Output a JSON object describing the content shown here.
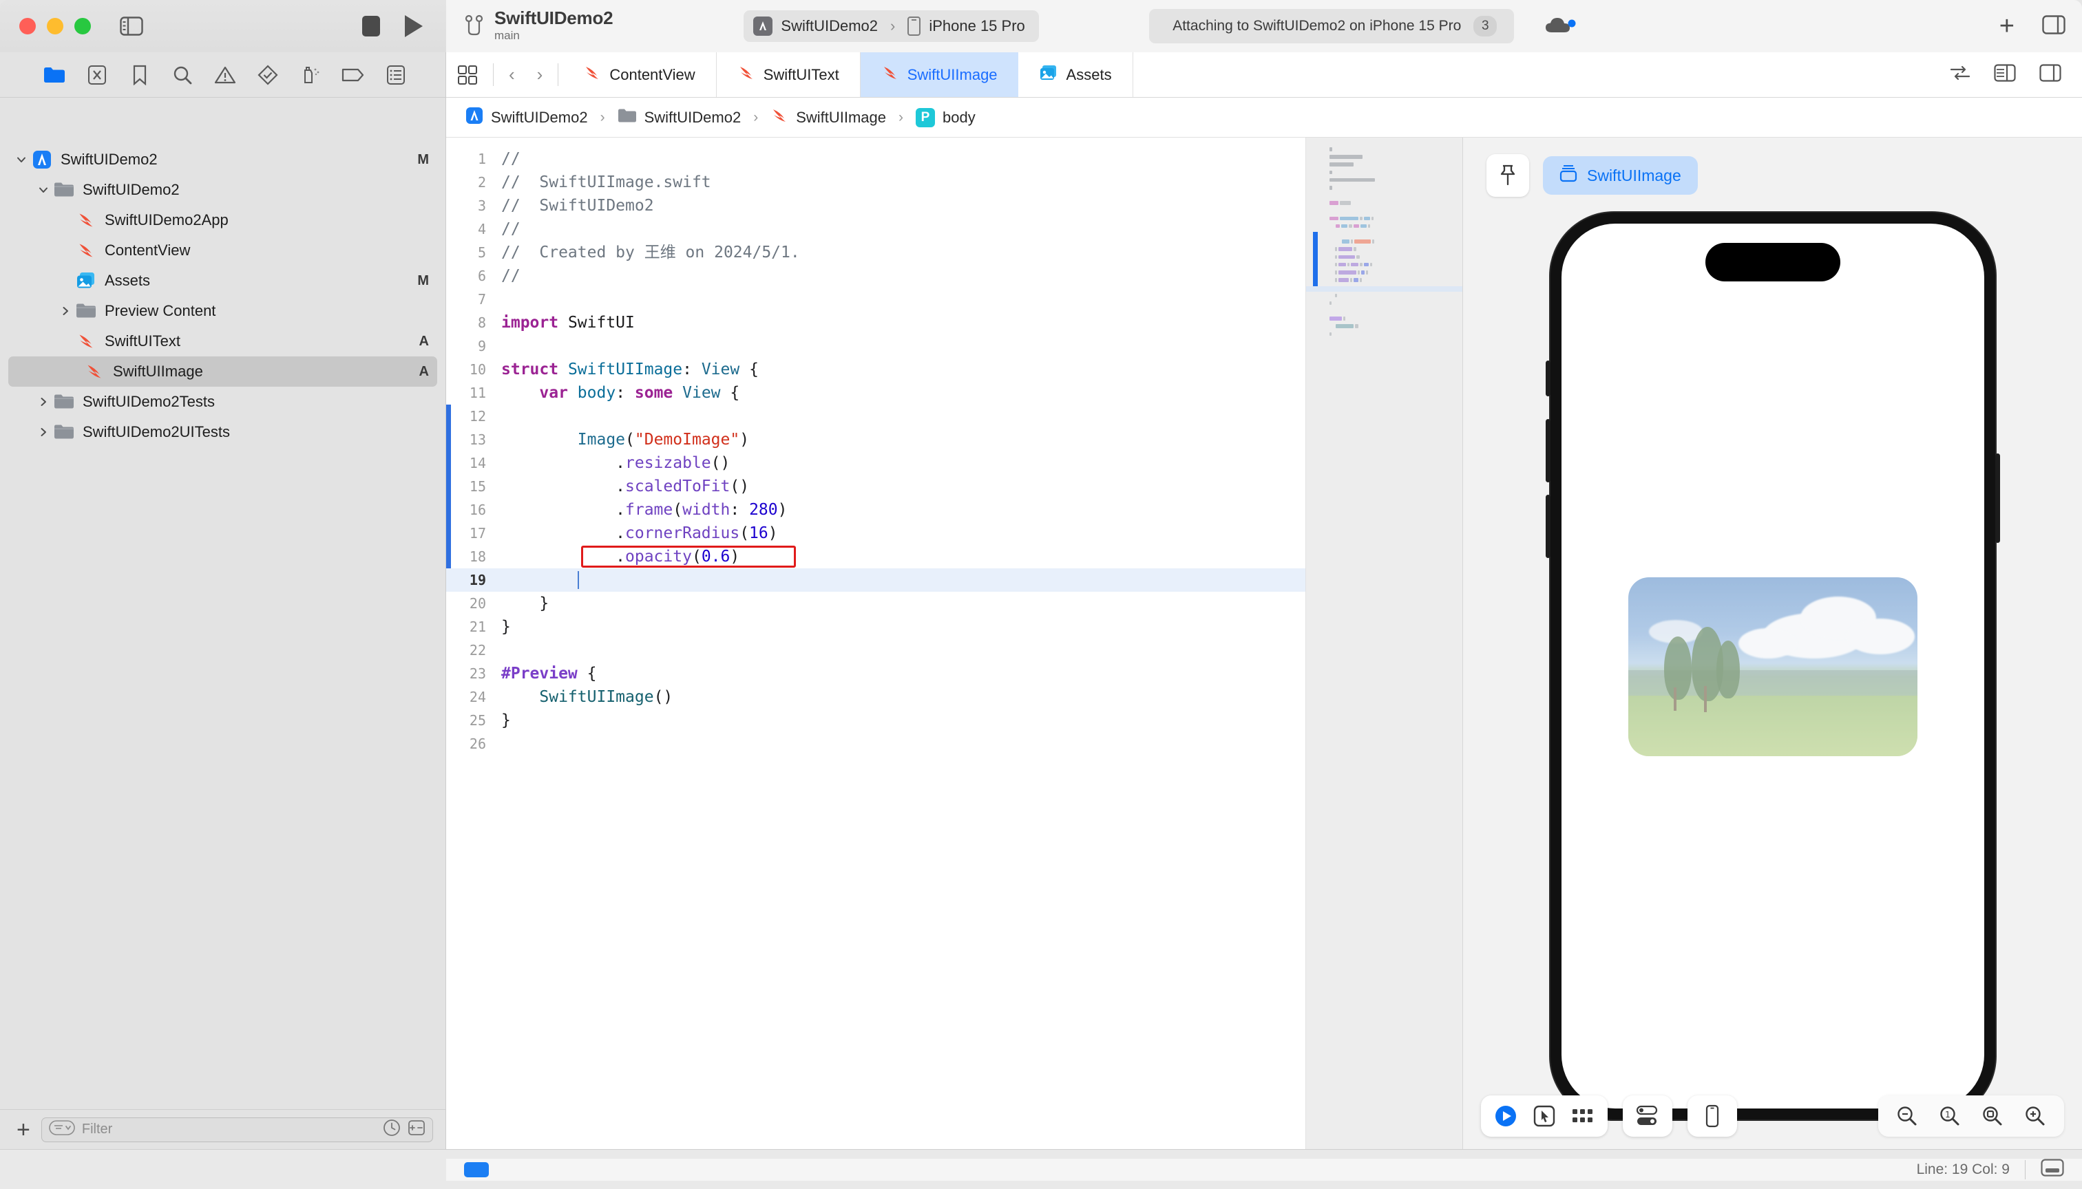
{
  "window": {
    "project_title": "SwiftUIDemo2",
    "branch": "main",
    "traffic_lights": [
      "close",
      "minimize",
      "zoom"
    ]
  },
  "toolbar": {
    "sidebar_toggle_icon": "sidebar-toggle-icon",
    "stop_icon": "stop-icon",
    "run_icon": "run-icon",
    "branch_icon": "source-control-branch-icon",
    "scheme": {
      "app_name": "SwiftUIDemo2",
      "separator": "›",
      "destination": "iPhone 15 Pro"
    },
    "status": {
      "message": "Attaching to SwiftUIDemo2 on iPhone 15 Pro",
      "count": "3"
    },
    "cloud_icon": "cloud-status-icon",
    "add_icon": "plus-icon",
    "inspector_toggle_icon": "inspector-toggle-icon"
  },
  "navigator_toolbar": {
    "icons": [
      "folder-project-navigator-icon",
      "source-control-navigator-icon",
      "bookmark-navigator-icon",
      "search-navigator-icon",
      "issue-navigator-icon",
      "test-navigator-icon",
      "debug-navigator-icon",
      "breakpoint-navigator-icon",
      "report-navigator-icon"
    ]
  },
  "navigator": {
    "tree": [
      {
        "label": "SwiftUIDemo2",
        "icon": "xcode-project-icon",
        "depth": 0,
        "disclosure": "open",
        "badge": "M",
        "selected": false
      },
      {
        "label": "SwiftUIDemo2",
        "icon": "folder-icon",
        "depth": 1,
        "disclosure": "open",
        "badge": "",
        "selected": false
      },
      {
        "label": "SwiftUIDemo2App",
        "icon": "swift-file-icon",
        "depth": 2,
        "disclosure": "none",
        "badge": "",
        "selected": false
      },
      {
        "label": "ContentView",
        "icon": "swift-file-icon",
        "depth": 2,
        "disclosure": "none",
        "badge": "",
        "selected": false
      },
      {
        "label": "Assets",
        "icon": "assets-catalog-icon",
        "depth": 2,
        "disclosure": "none",
        "badge": "M",
        "selected": false
      },
      {
        "label": "Preview Content",
        "icon": "folder-icon",
        "depth": 2,
        "disclosure": "closed",
        "badge": "",
        "selected": false
      },
      {
        "label": "SwiftUIText",
        "icon": "swift-file-icon",
        "depth": 2,
        "disclosure": "none",
        "badge": "A",
        "selected": false
      },
      {
        "label": "SwiftUIImage",
        "icon": "swift-file-icon",
        "depth": 2,
        "disclosure": "none",
        "badge": "A",
        "selected": true
      },
      {
        "label": "SwiftUIDemo2Tests",
        "icon": "folder-icon",
        "depth": 1,
        "disclosure": "closed",
        "badge": "",
        "selected": false
      },
      {
        "label": "SwiftUIDemo2UITests",
        "icon": "folder-icon",
        "depth": 1,
        "disclosure": "closed",
        "badge": "",
        "selected": false
      }
    ],
    "filter": {
      "placeholder": "Filter",
      "add_label": "+",
      "recent_icon": "clock-icon",
      "sourcecontrol_icon": "source-control-filter-icon"
    }
  },
  "editor": {
    "tabs": [
      {
        "label": "ContentView",
        "icon": "swift-file-icon",
        "active": false
      },
      {
        "label": "SwiftUIText",
        "icon": "swift-file-icon",
        "active": false
      },
      {
        "label": "SwiftUIImage",
        "icon": "swift-file-icon",
        "active": true
      },
      {
        "label": "Assets",
        "icon": "assets-catalog-icon",
        "active": false
      }
    ],
    "tab_nav": {
      "grid_icon": "tab-overview-icon",
      "back_icon": "chevron-left-icon",
      "forward_icon": "chevron-right-icon"
    },
    "tabbar_right_icons": [
      "code-review-icon",
      "split-editor-icon",
      "add-editor-icon"
    ],
    "jumpbar": [
      {
        "label": "SwiftUIDemo2",
        "icon": "xcode-project-icon"
      },
      {
        "label": "SwiftUIDemo2",
        "icon": "folder-icon"
      },
      {
        "label": "SwiftUIImage",
        "icon": "swift-file-icon"
      },
      {
        "label": "body",
        "icon": "property-badge-icon"
      }
    ],
    "jumpbar_separator": "›",
    "highlight_line": 18,
    "current_line": 19,
    "lines": [
      {
        "n": 1,
        "tokens": [
          {
            "t": "//",
            "c": "cmt"
          }
        ]
      },
      {
        "n": 2,
        "tokens": [
          {
            "t": "//  SwiftUIImage.swift",
            "c": "cmt"
          }
        ]
      },
      {
        "n": 3,
        "tokens": [
          {
            "t": "//  SwiftUIDemo2",
            "c": "cmt"
          }
        ]
      },
      {
        "n": 4,
        "tokens": [
          {
            "t": "//",
            "c": "cmt"
          }
        ]
      },
      {
        "n": 5,
        "tokens": [
          {
            "t": "//  Created by 王维 on 2024/5/1.",
            "c": "cmt"
          }
        ]
      },
      {
        "n": 6,
        "tokens": [
          {
            "t": "//",
            "c": "cmt"
          }
        ]
      },
      {
        "n": 7,
        "tokens": []
      },
      {
        "n": 8,
        "tokens": [
          {
            "t": "import",
            "c": "kw"
          },
          {
            "t": " SwiftUI",
            "c": ""
          }
        ]
      },
      {
        "n": 9,
        "tokens": []
      },
      {
        "n": 10,
        "tokens": [
          {
            "t": "struct",
            "c": "kw"
          },
          {
            "t": " ",
            "c": ""
          },
          {
            "t": "SwiftUIImage",
            "c": "typ"
          },
          {
            "t": ": ",
            "c": ""
          },
          {
            "t": "View",
            "c": "typ2"
          },
          {
            "t": " {",
            "c": ""
          }
        ]
      },
      {
        "n": 11,
        "tokens": [
          {
            "t": "    ",
            "c": ""
          },
          {
            "t": "var",
            "c": "kw"
          },
          {
            "t": " ",
            "c": ""
          },
          {
            "t": "body",
            "c": "typ"
          },
          {
            "t": ": ",
            "c": ""
          },
          {
            "t": "some",
            "c": "kw"
          },
          {
            "t": " ",
            "c": ""
          },
          {
            "t": "View",
            "c": "typ2"
          },
          {
            "t": " {",
            "c": ""
          }
        ]
      },
      {
        "n": 12,
        "tokens": []
      },
      {
        "n": 13,
        "tokens": [
          {
            "t": "        ",
            "c": ""
          },
          {
            "t": "Image",
            "c": "typ2"
          },
          {
            "t": "(",
            "c": ""
          },
          {
            "t": "\"DemoImage\"",
            "c": "str"
          },
          {
            "t": ")",
            "c": ""
          }
        ]
      },
      {
        "n": 14,
        "tokens": [
          {
            "t": "            .",
            "c": ""
          },
          {
            "t": "resizable",
            "c": "mth"
          },
          {
            "t": "()",
            "c": ""
          }
        ]
      },
      {
        "n": 15,
        "tokens": [
          {
            "t": "            .",
            "c": ""
          },
          {
            "t": "scaledToFit",
            "c": "mth"
          },
          {
            "t": "()",
            "c": ""
          }
        ]
      },
      {
        "n": 16,
        "tokens": [
          {
            "t": "            .",
            "c": ""
          },
          {
            "t": "frame",
            "c": "mth"
          },
          {
            "t": "(",
            "c": ""
          },
          {
            "t": "width",
            "c": "mth"
          },
          {
            "t": ": ",
            "c": ""
          },
          {
            "t": "280",
            "c": "num"
          },
          {
            "t": ")",
            "c": ""
          }
        ]
      },
      {
        "n": 17,
        "tokens": [
          {
            "t": "            .",
            "c": ""
          },
          {
            "t": "cornerRadius",
            "c": "mth"
          },
          {
            "t": "(",
            "c": ""
          },
          {
            "t": "16",
            "c": "num"
          },
          {
            "t": ")",
            "c": ""
          }
        ]
      },
      {
        "n": 18,
        "tokens": [
          {
            "t": "            .",
            "c": ""
          },
          {
            "t": "opacity",
            "c": "mth"
          },
          {
            "t": "(",
            "c": ""
          },
          {
            "t": "0.6",
            "c": "num"
          },
          {
            "t": ")",
            "c": ""
          }
        ]
      },
      {
        "n": 19,
        "tokens": [
          {
            "t": "        ",
            "c": ""
          }
        ]
      },
      {
        "n": 20,
        "tokens": [
          {
            "t": "    }",
            "c": ""
          }
        ]
      },
      {
        "n": 21,
        "tokens": [
          {
            "t": "}",
            "c": ""
          }
        ]
      },
      {
        "n": 22,
        "tokens": []
      },
      {
        "n": 23,
        "tokens": [
          {
            "t": "#Preview",
            "c": "mac"
          },
          {
            "t": " {",
            "c": ""
          }
        ]
      },
      {
        "n": 24,
        "tokens": [
          {
            "t": "    ",
            "c": ""
          },
          {
            "t": "SwiftUIImage",
            "c": "tealtype"
          },
          {
            "t": "()",
            "c": ""
          }
        ]
      },
      {
        "n": 25,
        "tokens": [
          {
            "t": "}",
            "c": ""
          }
        ]
      },
      {
        "n": 26,
        "tokens": []
      }
    ]
  },
  "canvas": {
    "pin_icon": "pin-icon",
    "preview_chip": {
      "label": "SwiftUIImage",
      "icon": "preview-variant-icon"
    },
    "device": "iPhone 15 Pro",
    "controls": [
      {
        "name": "live-preview-play-button",
        "icon": "play-circle-icon"
      },
      {
        "name": "selectable-mode-button",
        "icon": "pointer-select-icon"
      },
      {
        "name": "variants-button",
        "icon": "grid-variants-icon"
      }
    ],
    "device_settings_icon": "device-settings-toggles-icon",
    "device_bezel_icon": "device-bezel-icon",
    "zoom_controls": [
      {
        "name": "zoom-out-button",
        "icon": "magnifier-minus-icon"
      },
      {
        "name": "zoom-actual-size-button",
        "icon": "magnifier-one-icon"
      },
      {
        "name": "zoom-to-fit-button",
        "icon": "magnifier-fit-icon"
      },
      {
        "name": "zoom-in-button",
        "icon": "magnifier-plus-icon"
      }
    ]
  },
  "statusbar": {
    "line_col": "Line: 19  Col: 9",
    "debug_area_icon": "debug-area-toggle-icon",
    "blue_marker": "build-activity-marker"
  },
  "colors": {
    "accent_blue": "#1a6dff",
    "tab_active_bg": "#cfe3fd",
    "chip_blue_bg": "#c3dcfb",
    "highlight_red": "#e01b1b",
    "swift_orange": "#f05138",
    "current_line_bg": "#e8f0fb",
    "keyword_magenta": "#9b2393",
    "string_red": "#d12f1b",
    "number_blue": "#1c00cf",
    "method_purple": "#6f42c1",
    "comment_gray": "#6e7781",
    "type_teal": "#0b6e99"
  }
}
